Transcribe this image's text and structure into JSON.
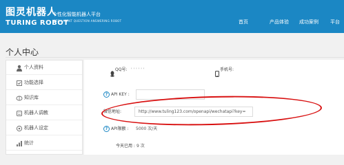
{
  "header": {
    "logo_cn": "图灵机器人",
    "logo_en": "TURING ROBOT",
    "slogan_cn": "个性化智能机器人平台",
    "slogan_en": "INTELLIGENT QUESTION ANSWERING ROBOT",
    "nav": [
      "首页",
      "产品体验",
      "成功案例",
      "平台"
    ]
  },
  "page": {
    "title": "个人中心"
  },
  "sidebar": {
    "items": [
      {
        "icon": "user-icon",
        "label": "个人资料"
      },
      {
        "icon": "function-icon",
        "label": "功能选择"
      },
      {
        "icon": "knowledge-icon",
        "label": "知识库"
      },
      {
        "icon": "robot-icon",
        "label": "机器人调教"
      },
      {
        "icon": "settings-icon",
        "label": "机器人设定"
      },
      {
        "icon": "stats-icon",
        "label": "统计"
      }
    ]
  },
  "profile": {
    "qq_label": "QQ号:",
    "qq_value": "' ' ' ' ' '",
    "phone_label": "手机号:"
  },
  "api": {
    "help_glyph": "?",
    "key_label": "API KEY :",
    "key_value": "",
    "wechat_label": "微信地址:",
    "wechat_value": "http://www.tuling123.com/openapi/wechatapi?key=",
    "quota_label": "API限额 :",
    "quota_value": "5000 次/天",
    "used_label": "今天已用 :",
    "used_value": "9 次"
  },
  "colors": {
    "header_bg": "#1b87c4",
    "highlight": "#d80f0f"
  }
}
